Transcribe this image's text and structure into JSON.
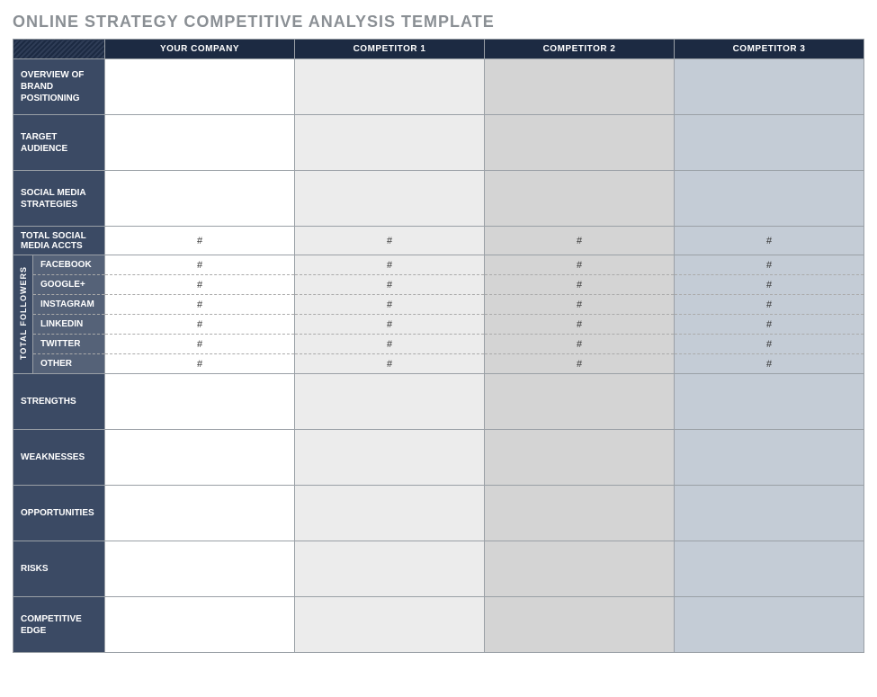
{
  "title": "ONLINE STRATEGY COMPETITIVE ANALYSIS TEMPLATE",
  "columns": {
    "your": "YOUR COMPANY",
    "c1": "COMPETITOR 1",
    "c2": "COMPETITOR 2",
    "c3": "COMPETITOR 3"
  },
  "rows": {
    "overview": "OVERVIEW OF BRAND POSITIONING",
    "target": "TARGET AUDIENCE",
    "social_strat": "SOCIAL MEDIA STRATEGIES",
    "total_accts": "TOTAL SOCIAL MEDIA ACCTS",
    "total_followers": "TOTAL FOLLOWERS",
    "facebook": "FACEBOOK",
    "google": "GOOGLE+",
    "instagram": "INSTAGRAM",
    "linkedin": "LINKEDIN",
    "twitter": "TWITTER",
    "other": "OTHER",
    "strengths": "STRENGTHS",
    "weaknesses": "WEAKNESSES",
    "opportunities": "OPPORTUNITIES",
    "risks": "RISKS",
    "edge": "COMPETITIVE EDGE"
  },
  "placeholder": "#",
  "values": {
    "overview": {
      "your": "",
      "c1": "",
      "c2": "",
      "c3": ""
    },
    "target": {
      "your": "",
      "c1": "",
      "c2": "",
      "c3": ""
    },
    "social_strat": {
      "your": "",
      "c1": "",
      "c2": "",
      "c3": ""
    },
    "total_accts": {
      "your": "#",
      "c1": "#",
      "c2": "#",
      "c3": "#"
    },
    "facebook": {
      "your": "#",
      "c1": "#",
      "c2": "#",
      "c3": "#"
    },
    "google": {
      "your": "#",
      "c1": "#",
      "c2": "#",
      "c3": "#"
    },
    "instagram": {
      "your": "#",
      "c1": "#",
      "c2": "#",
      "c3": "#"
    },
    "linkedin": {
      "your": "#",
      "c1": "#",
      "c2": "#",
      "c3": "#"
    },
    "twitter": {
      "your": "#",
      "c1": "#",
      "c2": "#",
      "c3": "#"
    },
    "other": {
      "your": "#",
      "c1": "#",
      "c2": "#",
      "c3": "#"
    },
    "strengths": {
      "your": "",
      "c1": "",
      "c2": "",
      "c3": ""
    },
    "weaknesses": {
      "your": "",
      "c1": "",
      "c2": "",
      "c3": ""
    },
    "opportunities": {
      "your": "",
      "c1": "",
      "c2": "",
      "c3": ""
    },
    "risks": {
      "your": "",
      "c1": "",
      "c2": "",
      "c3": ""
    },
    "edge": {
      "your": "",
      "c1": "",
      "c2": "",
      "c3": ""
    }
  }
}
